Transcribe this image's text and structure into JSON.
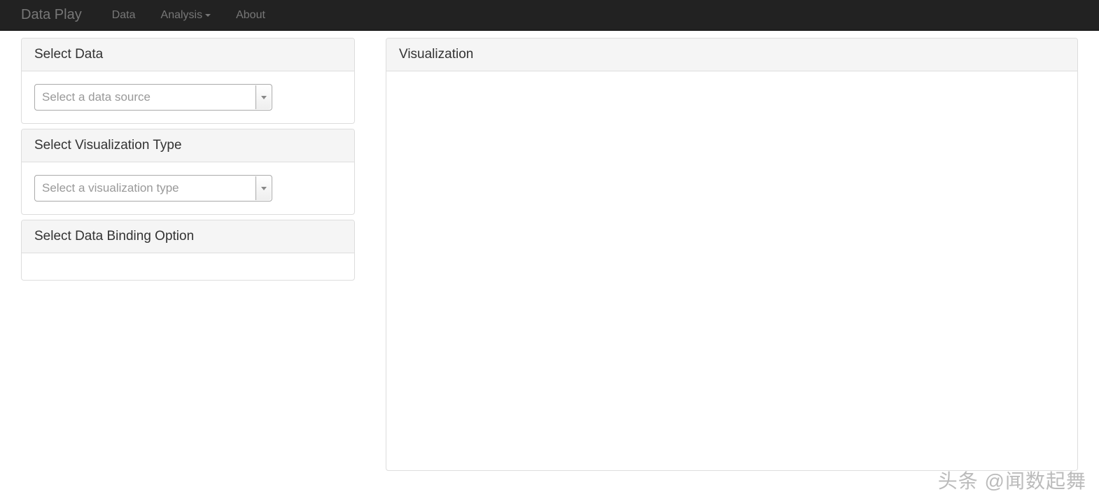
{
  "navbar": {
    "brand": "Data Play",
    "items": [
      {
        "label": "Data",
        "hasDropdown": false
      },
      {
        "label": "Analysis",
        "hasDropdown": true
      },
      {
        "label": "About",
        "hasDropdown": false
      }
    ]
  },
  "panels": {
    "selectData": {
      "title": "Select Data",
      "placeholder": "Select a data source"
    },
    "selectViz": {
      "title": "Select Visualization Type",
      "placeholder": "Select a visualization type"
    },
    "selectBinding": {
      "title": "Select Data Binding Option"
    },
    "visualization": {
      "title": "Visualization"
    }
  },
  "watermark": "头条 @闻数起舞"
}
